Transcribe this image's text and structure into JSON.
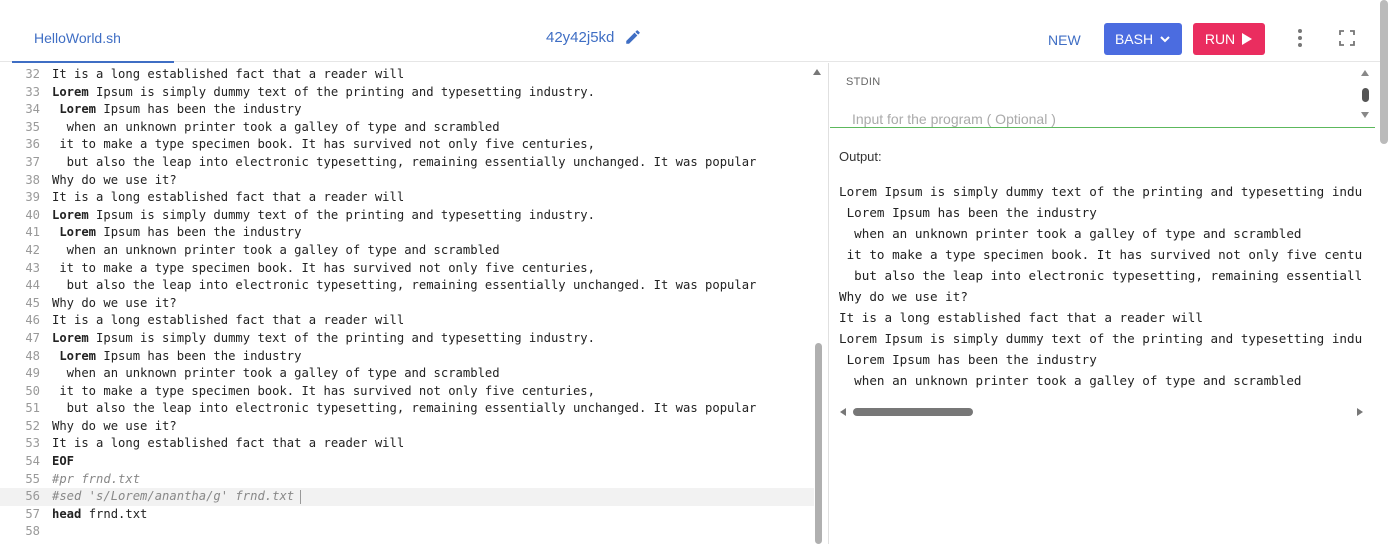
{
  "toolbar": {
    "file_tab": "HelloWorld.sh",
    "project_title": "42y42j5kd",
    "new_label": "NEW",
    "language_label": "BASH",
    "run_label": "RUN"
  },
  "icons": {
    "edit": "pencil-icon",
    "language_dropdown": "chevron-down-icon",
    "run": "play-icon",
    "menu": "kebab-icon",
    "fullscreen": "fullscreen-icon"
  },
  "colors": {
    "accent": "#3f6ec4",
    "language_button": "#4b6ce0",
    "run_button": "#ea2d5f",
    "stdin_underline": "#5cb85c"
  },
  "editor": {
    "lines": [
      {
        "num": "32",
        "kw": "",
        "text": "It is a long established fact that a reader will"
      },
      {
        "num": "33",
        "kw": "Lorem",
        "text": " Ipsum is simply dummy text of the printing and typesetting industry."
      },
      {
        "num": "34",
        "kw": " Lorem",
        "text": " Ipsum has been the industry"
      },
      {
        "num": "35",
        "kw": "",
        "text": "  when an unknown printer took a galley of type and scrambled"
      },
      {
        "num": "36",
        "kw": "",
        "text": " it to make a type specimen book. It has survived not only five centuries,"
      },
      {
        "num": "37",
        "kw": "",
        "text": "  but also the leap into electronic typesetting, remaining essentially unchanged. It was popular"
      },
      {
        "num": "38",
        "kw": "",
        "text": "Why do we use it?"
      },
      {
        "num": "39",
        "kw": "",
        "text": "It is a long established fact that a reader will"
      },
      {
        "num": "40",
        "kw": "Lorem",
        "text": " Ipsum is simply dummy text of the printing and typesetting industry."
      },
      {
        "num": "41",
        "kw": " Lorem",
        "text": " Ipsum has been the industry"
      },
      {
        "num": "42",
        "kw": "",
        "text": "  when an unknown printer took a galley of type and scrambled"
      },
      {
        "num": "43",
        "kw": "",
        "text": " it to make a type specimen book. It has survived not only five centuries,"
      },
      {
        "num": "44",
        "kw": "",
        "text": "  but also the leap into electronic typesetting, remaining essentially unchanged. It was popular"
      },
      {
        "num": "45",
        "kw": "",
        "text": "Why do we use it?"
      },
      {
        "num": "46",
        "kw": "",
        "text": "It is a long established fact that a reader will"
      },
      {
        "num": "47",
        "kw": "Lorem",
        "text": " Ipsum is simply dummy text of the printing and typesetting industry."
      },
      {
        "num": "48",
        "kw": " Lorem",
        "text": " Ipsum has been the industry"
      },
      {
        "num": "49",
        "kw": "",
        "text": "  when an unknown printer took a galley of type and scrambled"
      },
      {
        "num": "50",
        "kw": "",
        "text": " it to make a type specimen book. It has survived not only five centuries,"
      },
      {
        "num": "51",
        "kw": "",
        "text": "  but also the leap into electronic typesetting, remaining essentially unchanged. It was popular"
      },
      {
        "num": "52",
        "kw": "",
        "text": "Why do we use it?"
      },
      {
        "num": "53",
        "kw": "",
        "text": "It is a long established fact that a reader will"
      },
      {
        "num": "54",
        "kw": "EOF",
        "text": ""
      },
      {
        "num": "55",
        "kw": "",
        "text": "#pr frnd.txt",
        "comment": true
      },
      {
        "num": "56",
        "kw": "",
        "text": "#sed 's/Lorem/anantha/g' frnd.txt",
        "comment": true,
        "active": true
      },
      {
        "num": "57",
        "kw": "head",
        "text": " frnd.txt"
      },
      {
        "num": "58",
        "kw": "",
        "text": ""
      }
    ]
  },
  "stdin": {
    "label": "STDIN",
    "placeholder": "Input for the program ( Optional )"
  },
  "output": {
    "label": "Output:",
    "lines": [
      "Lorem Ipsum is simply dummy text of the printing and typesetting indu",
      " Lorem Ipsum has been the industry",
      "  when an unknown printer took a galley of type and scrambled",
      " it to make a type specimen book. It has survived not only five centu",
      "  but also the leap into electronic typesetting, remaining essentiall",
      "Why do we use it?",
      "It is a long established fact that a reader will",
      "Lorem Ipsum is simply dummy text of the printing and typesetting indu",
      " Lorem Ipsum has been the industry",
      "  when an unknown printer took a galley of type and scrambled"
    ]
  }
}
